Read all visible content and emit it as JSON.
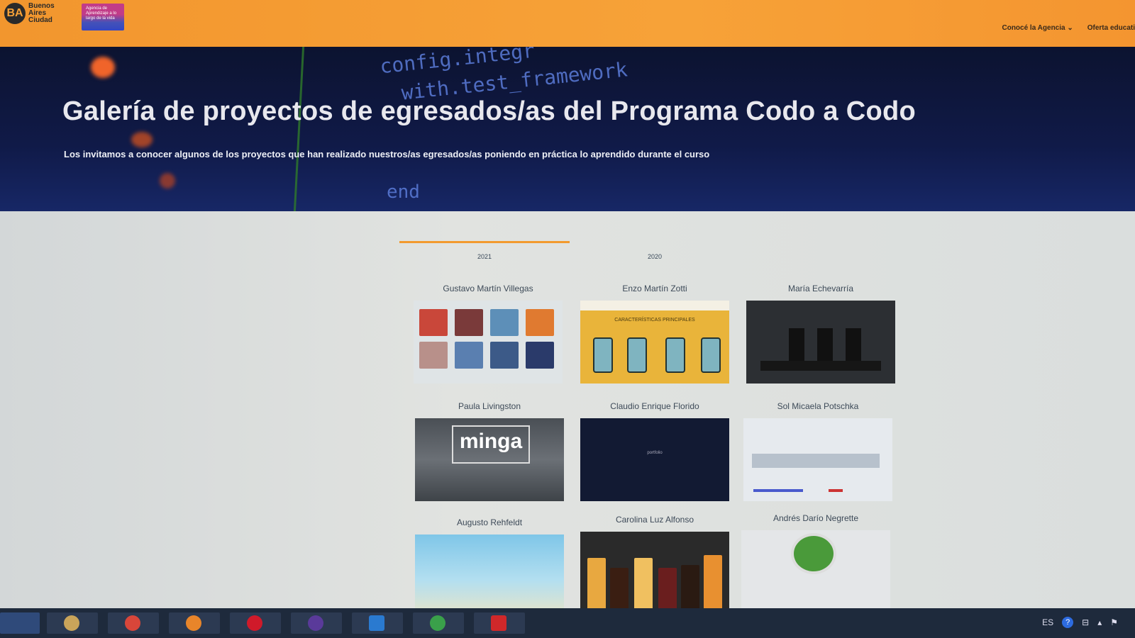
{
  "header": {
    "logo_initial": "BA",
    "logo_text": "Buenos Aires Ciudad",
    "agencia_text": "Agencia de Aprendizaje a lo largo de la vida",
    "nav": [
      "Conocé la Agencia ⌄",
      "Oferta educati"
    ]
  },
  "hero": {
    "code_lines": [
      "config.integr",
      "with.test_framework",
      "end"
    ],
    "title": "Galería de proyectos de egresados/as del Programa Codo a Codo",
    "subtitle": "Los invitamos a conocer algunos de los proyectos que han realizado nuestros/as egresados/as poniendo en práctica lo aprendido durante el curso"
  },
  "tabs": [
    "2021",
    "2020"
  ],
  "projects": [
    {
      "name": "Gustavo Martín Villegas"
    },
    {
      "name": "Enzo Martín Zotti",
      "thumb_heading": "CARACTERÍSTICAS PRINCIPALES"
    },
    {
      "name": "María Echevarría"
    },
    {
      "name": "Paula Livingston",
      "thumb_logo": "minga"
    },
    {
      "name": "Claudio Enrique Florido",
      "thumb_text": "portfolio"
    },
    {
      "name": "Sol Micaela Potschka"
    },
    {
      "name": "Augusto Rehfeldt"
    },
    {
      "name": "Carolina Luz Alfonso"
    },
    {
      "name": "Andrés Darío Negrette"
    }
  ],
  "taskbar": {
    "lang": "ES",
    "help": "?"
  },
  "colors": {
    "header_orange": "#f7a238",
    "hero_navy": "#101a48",
    "tab_active": "#f29a2e"
  }
}
